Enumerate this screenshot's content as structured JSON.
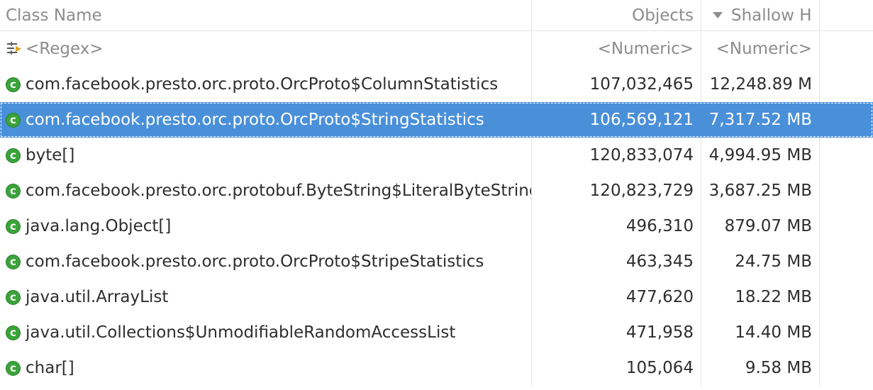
{
  "header": {
    "class_name": "Class Name",
    "objects": "Objects",
    "shallow": "Shallow H"
  },
  "filter": {
    "class_name": "<Regex>",
    "objects": "<Numeric>",
    "shallow": "<Numeric>"
  },
  "rows": [
    {
      "icon": "class-icon",
      "name": "com.facebook.presto.orc.proto.OrcProto$ColumnStatistics",
      "objects": "107,032,465",
      "shallow": "12,248.89 M"
    },
    {
      "icon": "class-icon",
      "name": "com.facebook.presto.orc.proto.OrcProto$StringStatistics",
      "objects": "106,569,121",
      "shallow": "7,317.52 MB"
    },
    {
      "icon": "class-icon",
      "name": "byte[]",
      "objects": "120,833,074",
      "shallow": "4,994.95 MB"
    },
    {
      "icon": "class-icon",
      "name": "com.facebook.presto.orc.protobuf.ByteString$LiteralByteString",
      "objects": "120,823,729",
      "shallow": "3,687.25 MB"
    },
    {
      "icon": "class-icon",
      "name": "java.lang.Object[]",
      "objects": "496,310",
      "shallow": "879.07 MB"
    },
    {
      "icon": "class-icon",
      "name": "com.facebook.presto.orc.proto.OrcProto$StripeStatistics",
      "objects": "463,345",
      "shallow": "24.75 MB"
    },
    {
      "icon": "class-icon",
      "name": "java.util.ArrayList",
      "objects": "477,620",
      "shallow": "18.22 MB"
    },
    {
      "icon": "class-icon",
      "name": "java.util.Collections$UnmodifiableRandomAccessList",
      "objects": "471,958",
      "shallow": "14.40 MB"
    },
    {
      "icon": "class-icon",
      "name": "char[]",
      "objects": "105,064",
      "shallow": "9.58 MB"
    }
  ],
  "selected_row": 1,
  "colors": {
    "selection": "#4a90d9",
    "class_icon": "#3aa43a"
  }
}
